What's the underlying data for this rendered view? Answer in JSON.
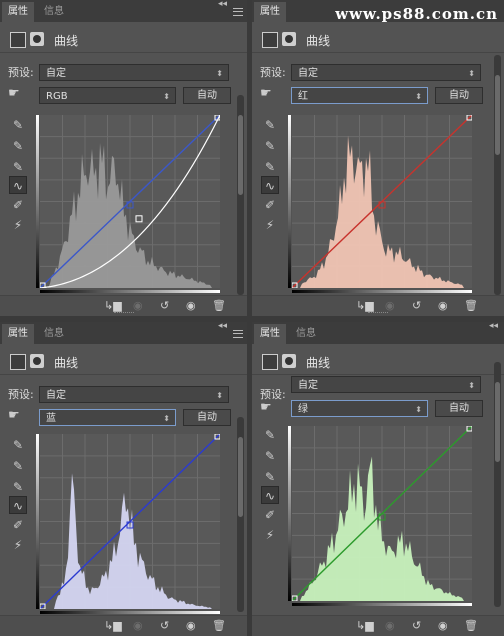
{
  "watermark": "www.ps88.com.cn",
  "tabs": {
    "properties": "属性",
    "info": "信息"
  },
  "panel_title": "曲线",
  "preset_label": "预设:",
  "preset_value": "自定",
  "auto_label": "自动",
  "panels": [
    {
      "id": "rgb",
      "channel": "RGB",
      "curve_color": "#3b57c9",
      "hist_color": "#9a9a9a",
      "extra_curve_color": "#ffffff"
    },
    {
      "id": "red",
      "channel": "红",
      "curve_color": "#c8322c",
      "hist_color": "#f1c5b4"
    },
    {
      "id": "blue",
      "channel": "蓝",
      "curve_color": "#2b3ad0",
      "hist_color": "#d5d6f2"
    },
    {
      "id": "green",
      "channel": "绿",
      "curve_color": "#2c9b2c",
      "hist_color": "#c8f2bd"
    }
  ],
  "icons": [
    "curves-icon",
    "mask-icon",
    "hand-icon",
    "eyedropper-black-icon",
    "eyedropper-gray-icon",
    "eyedropper-white-icon",
    "curve-tool-icon",
    "pencil-icon",
    "smooth-icon",
    "clip-icon",
    "view-previous-icon",
    "reset-icon",
    "visibility-icon",
    "trash-icon"
  ]
}
